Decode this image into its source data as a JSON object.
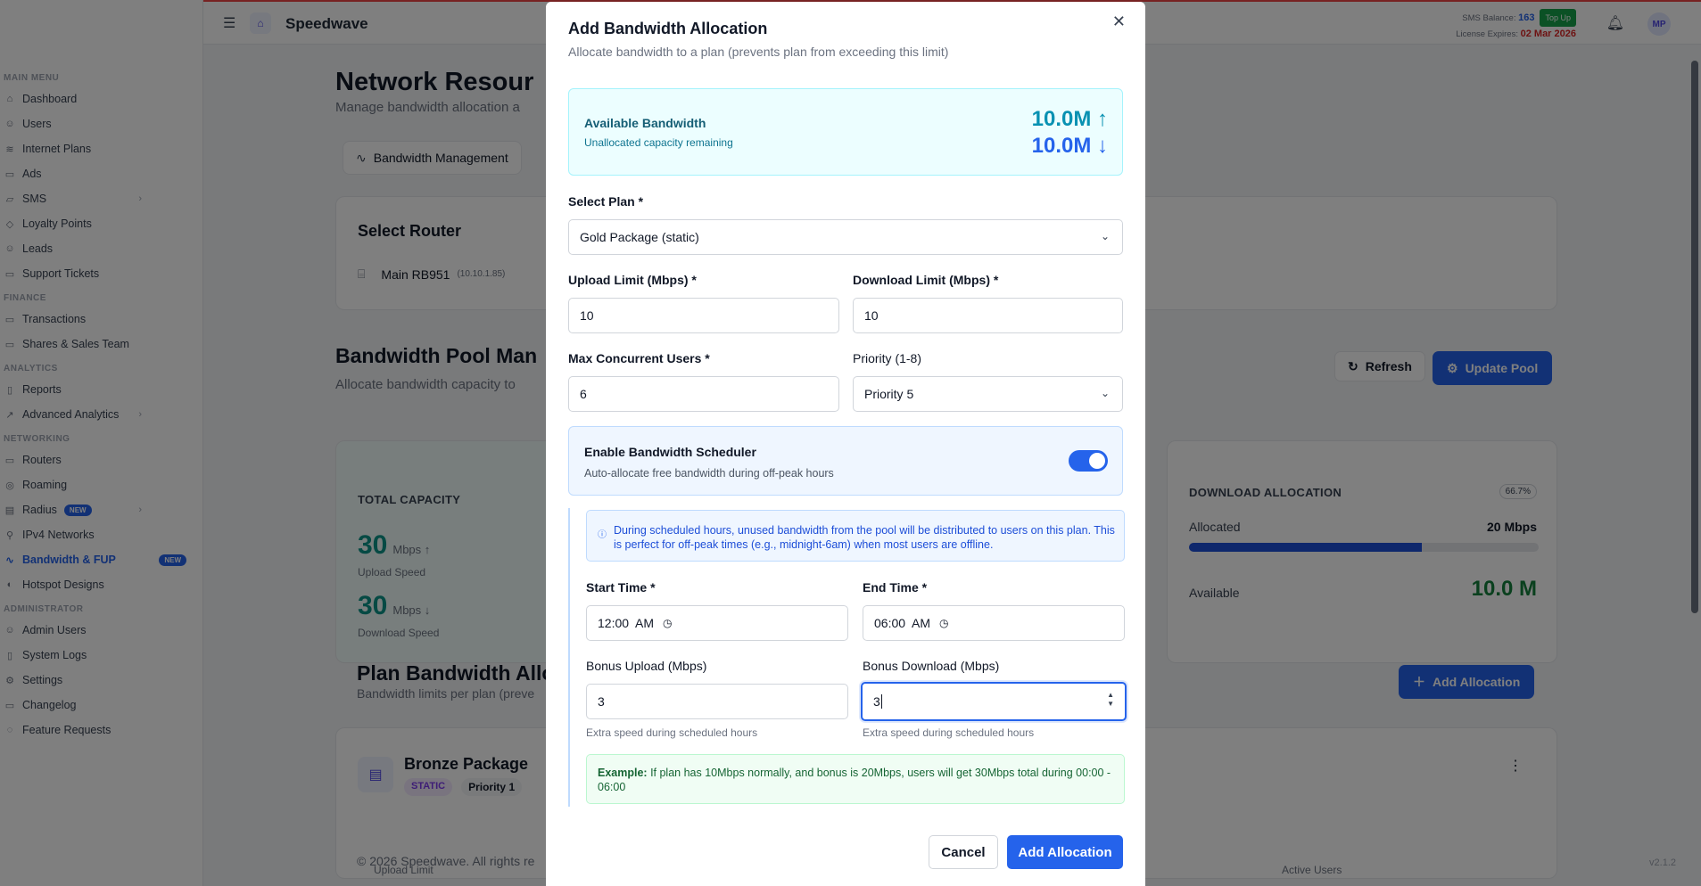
{
  "app": {
    "brand": "Speedwave",
    "sms_balance_label": "SMS Balance:",
    "sms_balance_value": "163",
    "top_up": "Top Up",
    "license_label": "License Expires:",
    "license_value": "02 Mar 2026",
    "avatar": "MP"
  },
  "sidebar": {
    "sections": {
      "main": "MAIN MENU",
      "finance": "FINANCE",
      "analytics": "ANALYTICS",
      "networking": "NETWORKING",
      "administrator": "ADMINISTRATOR"
    },
    "items": {
      "dashboard": "Dashboard",
      "users": "Users",
      "internet_plans": "Internet Plans",
      "ads": "Ads",
      "sms": "SMS",
      "loyalty": "Loyalty Points",
      "leads": "Leads",
      "support": "Support Tickets",
      "transactions": "Transactions",
      "shares": "Shares & Sales Team",
      "reports": "Reports",
      "advanced_analytics": "Advanced Analytics",
      "routers": "Routers",
      "roaming": "Roaming",
      "radius": "Radius",
      "ipv4": "IPv4 Networks",
      "bandwidth": "Bandwidth & FUP",
      "hotspot": "Hotspot Designs",
      "admin_users": "Admin Users",
      "system_logs": "System Logs",
      "settings": "Settings",
      "changelog": "Changelog",
      "feature_requests": "Feature Requests"
    },
    "badge_new": "NEW"
  },
  "page": {
    "title": "Network Resour",
    "subtitle": "Manage bandwidth allocation a",
    "tab_bandwidth": "Bandwidth Management",
    "select_router": "Select Router",
    "router_name": "Main RB951",
    "router_ip": "(10.10.1.85)",
    "pool_title": "Bandwidth Pool Man",
    "pool_sub": "Allocate bandwidth capacity to",
    "refresh": "Refresh",
    "update_pool": "Update Pool",
    "total_capacity": "TOTAL CAPACITY",
    "upload_num": "30",
    "upload_unit": "Mbps ↑",
    "upload_caption": "Upload Speed",
    "download_num": "30",
    "download_unit": "Mbps ↓",
    "download_caption": "Download Speed",
    "download_allocation": "DOWNLOAD ALLOCATION",
    "alloc_pct": "66.7%",
    "alloc_pct_value": 0.667,
    "allocated_label": "Allocated",
    "allocated_value": "20 Mbps",
    "available_label": "Available",
    "available_value": "10.0 M",
    "plan_bw_title": "Plan Bandwidth Allo",
    "plan_bw_sub": "Bandwidth limits per plan (preve",
    "add_allocation_bg": "Add Allocation",
    "plan_name": "Bronze Package",
    "plan_type": "STATIC",
    "plan_priority": "Priority 1",
    "col_upload_limit": "Upload Limit",
    "col_active_users": "Active Users",
    "footer": "© 2026 Speedwave. All rights re",
    "version": "v2.1.2"
  },
  "modal": {
    "title": "Add Bandwidth Allocation",
    "subtitle": "Allocate bandwidth to a plan (prevents plan from exceeding this limit)",
    "available_label": "Available Bandwidth",
    "available_sub": "Unallocated capacity remaining",
    "available_up": "10.0M ↑",
    "available_down": "10.0M ↓",
    "select_plan_label": "Select Plan *",
    "select_plan_value": "Gold Package (static)",
    "upload_label": "Upload Limit (Mbps) *",
    "upload_value": "10",
    "download_label": "Download Limit (Mbps) *",
    "download_value": "10",
    "max_users_label": "Max Concurrent Users *",
    "max_users_value": "6",
    "priority_label": "Priority (1-8)",
    "priority_value": "Priority 5",
    "scheduler_title": "Enable Bandwidth Scheduler",
    "scheduler_sub": "Auto-allocate free bandwidth during off-peak hours",
    "scheduler_enabled": true,
    "info_text": "During scheduled hours, unused bandwidth from the pool will be distributed to users on this plan. This is perfect for off-peak times (e.g., midnight-6am) when most users are offline.",
    "start_label": "Start Time *",
    "start_value": "12:00  AM",
    "end_label": "End Time *",
    "end_value": "06:00  AM",
    "bonus_up_label": "Bonus Upload (Mbps)",
    "bonus_up_value": "3",
    "bonus_down_label": "Bonus Download (Mbps)",
    "bonus_down_value": "3",
    "helper_text": "Extra speed during scheduled hours",
    "example_label": "Example:",
    "example_text": " If plan has 10Mbps normally, and bonus is 20Mbps, users will get 30Mbps total during 00:00 - 06:00",
    "cancel": "Cancel",
    "add": "Add Allocation"
  },
  "colors": {
    "primary": "#2563eb",
    "teal": "#0891b2",
    "license_red": "#dc2626"
  }
}
